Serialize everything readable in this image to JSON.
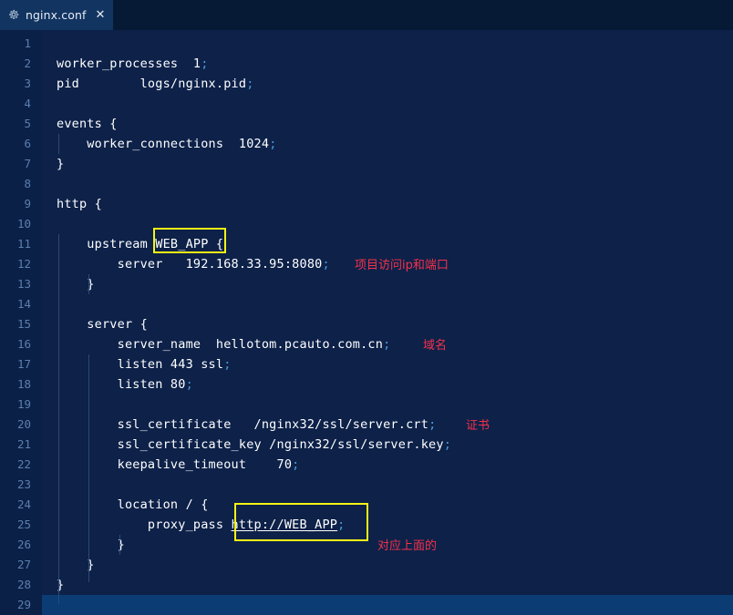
{
  "window": {
    "title": "nginx.conf",
    "background_color": "#0d2149",
    "gutter_color": "#0b2047"
  },
  "tabbar": {
    "tabs": [
      {
        "label": "nginx.conf",
        "icon": "gear-icon",
        "close_label": "✕",
        "active": true
      }
    ],
    "active_tab_color": "#123461"
  },
  "editor": {
    "language": "nginx",
    "current_line": 29,
    "current_line_color": "#0b3c74",
    "line_number_color": "#5b7fae",
    "text_color": "#ffffff",
    "punctuation_color": "#4a9ad4",
    "lines": [
      {
        "n": 1,
        "code": ""
      },
      {
        "n": 2,
        "code": "worker_processes  1;"
      },
      {
        "n": 3,
        "code": "pid        logs/nginx.pid;"
      },
      {
        "n": 4,
        "code": ""
      },
      {
        "n": 5,
        "code": "events {"
      },
      {
        "n": 6,
        "code": "    worker_connections  1024;"
      },
      {
        "n": 7,
        "code": "}"
      },
      {
        "n": 8,
        "code": ""
      },
      {
        "n": 9,
        "code": "http {"
      },
      {
        "n": 10,
        "code": ""
      },
      {
        "n": 11,
        "code": "    upstream WEB_APP {"
      },
      {
        "n": 12,
        "code": "        server   192.168.33.95:8080;"
      },
      {
        "n": 13,
        "code": "    }"
      },
      {
        "n": 14,
        "code": ""
      },
      {
        "n": 15,
        "code": "    server {"
      },
      {
        "n": 16,
        "code": "        server_name  hellotom.pcauto.com.cn;"
      },
      {
        "n": 17,
        "code": "        listen 443 ssl;"
      },
      {
        "n": 18,
        "code": "        listen 80;"
      },
      {
        "n": 19,
        "code": ""
      },
      {
        "n": 20,
        "code": "        ssl_certificate   /nginx32/ssl/server.crt;"
      },
      {
        "n": 21,
        "code": "        ssl_certificate_key /nginx32/ssl/server.key;"
      },
      {
        "n": 22,
        "code": "        keepalive_timeout    70;"
      },
      {
        "n": 23,
        "code": ""
      },
      {
        "n": 24,
        "code": "        location / {"
      },
      {
        "n": 25,
        "code": "            proxy_pass http://WEB_APP;"
      },
      {
        "n": 26,
        "code": "        }"
      },
      {
        "n": 27,
        "code": "    }"
      },
      {
        "n": 28,
        "code": "}"
      },
      {
        "n": 29,
        "code": ""
      }
    ]
  },
  "annotations": {
    "color": "#f4314a",
    "highlight_color": "#f5f514",
    "notes": [
      {
        "id": "ip-port",
        "text": "项目访问ip和端口",
        "line": 12
      },
      {
        "id": "domain",
        "text": "域名",
        "line": 16
      },
      {
        "id": "certificate",
        "text": "证书",
        "line": 20
      },
      {
        "id": "matches-above",
        "text": "对应上面的",
        "line": 26
      }
    ],
    "boxes": [
      {
        "id": "upstream-name-box",
        "target": "WEB_APP",
        "line": 11
      },
      {
        "id": "proxy-pass-box",
        "target": "http://WEB_APP;",
        "line": 25
      }
    ]
  }
}
